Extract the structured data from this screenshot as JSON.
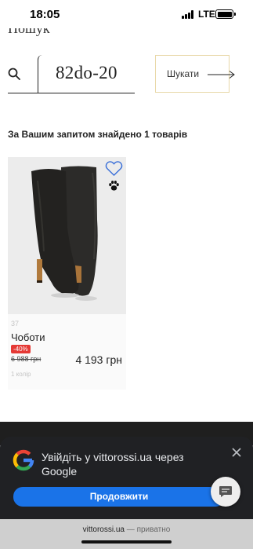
{
  "status_bar": {
    "time": "18:05",
    "network": "LTE"
  },
  "search": {
    "heading": "Пошук",
    "query": "82do-20",
    "button_label": "Шукати"
  },
  "results": {
    "summary": "За Вашим запитом знайдено 1 товарів"
  },
  "products": [
    {
      "size": "37",
      "name": "Чоботи",
      "discount": "-40%",
      "old_price": "6 988 грн",
      "price": "4 193 грн",
      "colors": "1 колір",
      "icons": [
        "heart-icon",
        "paw-icon"
      ]
    }
  ],
  "google_signin": {
    "title": "Увійдіть у vittorossi.ua через Google",
    "continue_label": "Продовжити"
  },
  "browser": {
    "domain": "vittorossi.ua",
    "separator": "—",
    "mode": "приватно"
  },
  "colors": {
    "accent_border": "#e8d8a8",
    "discount_red": "#e53935",
    "google_blue": "#1a73e8",
    "sheet_dark": "#202124"
  }
}
